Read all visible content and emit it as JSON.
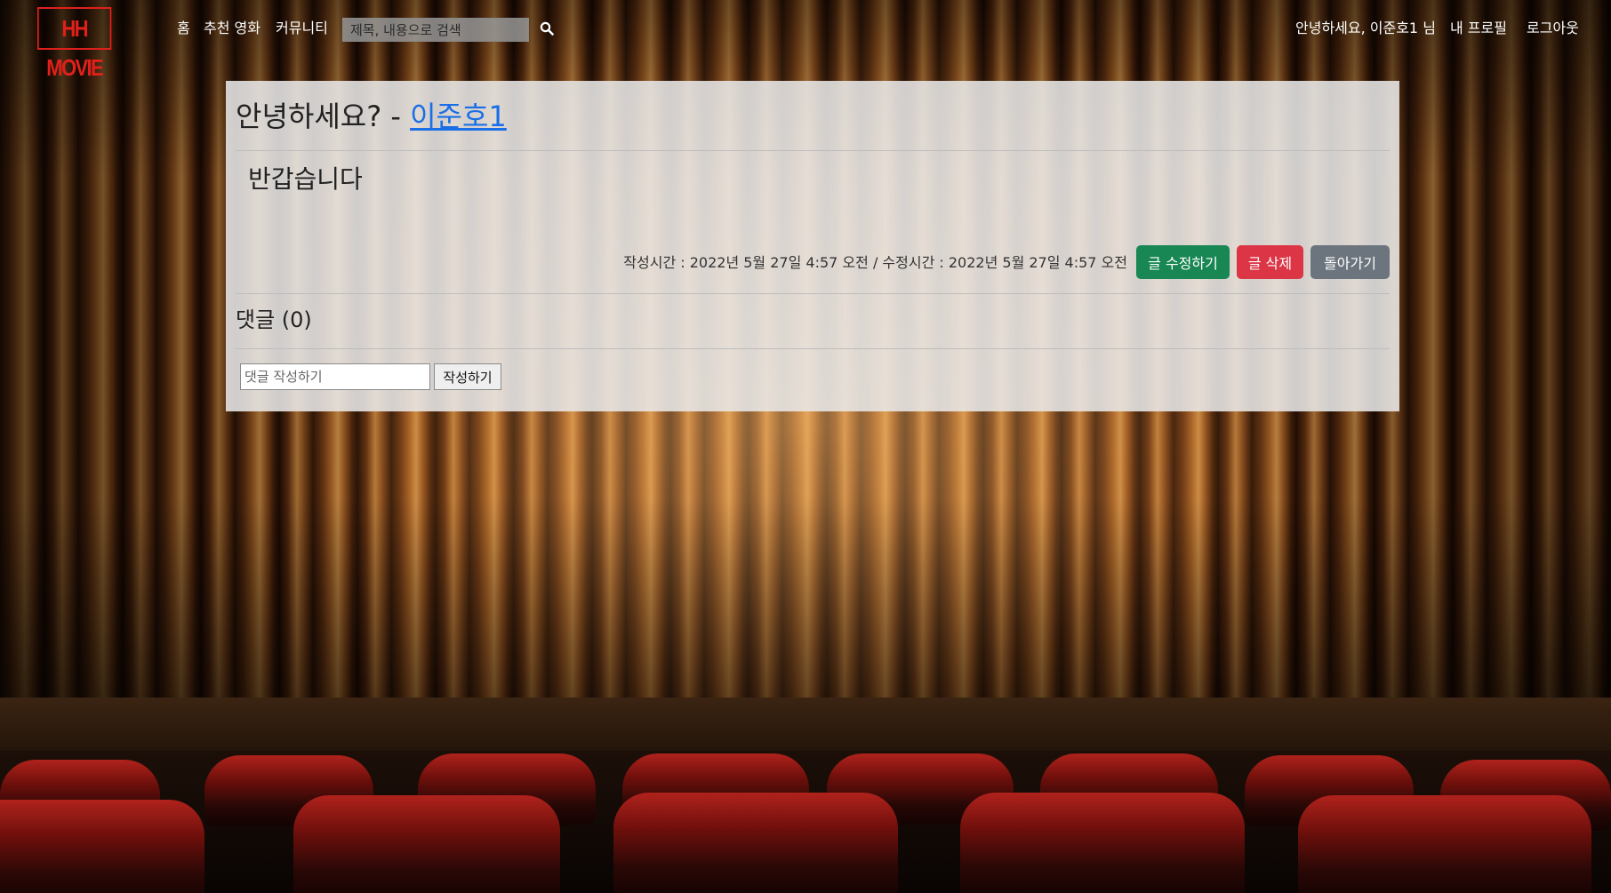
{
  "brand": {
    "logo_text": "HH MOVIE",
    "accent": "#e0201a"
  },
  "nav": {
    "home": "홈",
    "recommended": "추천 영화",
    "community": "커뮤니티",
    "search_placeholder": "제목, 내용으로 검색",
    "search_icon": "search-icon",
    "greeting": "안녕하세요, 이준호1 님",
    "profile": "내 프로필",
    "logout": "로그아웃"
  },
  "post": {
    "title": "안녕하세요? -",
    "author": "이준호1",
    "body": "반갑습니다",
    "meta": "작성시간 : 2022년 5월 27일 4:57 오전 / 수정시간 : 2022년 5월 27일 4:57 오전",
    "edit_label": "글 수정하기",
    "delete_label": "글 삭제",
    "back_label": "돌아가기",
    "colors": {
      "edit": "#198754",
      "delete": "#dc3545",
      "back": "#6c757d",
      "link": "#1a6fe6"
    }
  },
  "comments": {
    "title": "댓글 (0)",
    "input_placeholder": "댓글 작성하기",
    "submit_label": "작성하기"
  }
}
